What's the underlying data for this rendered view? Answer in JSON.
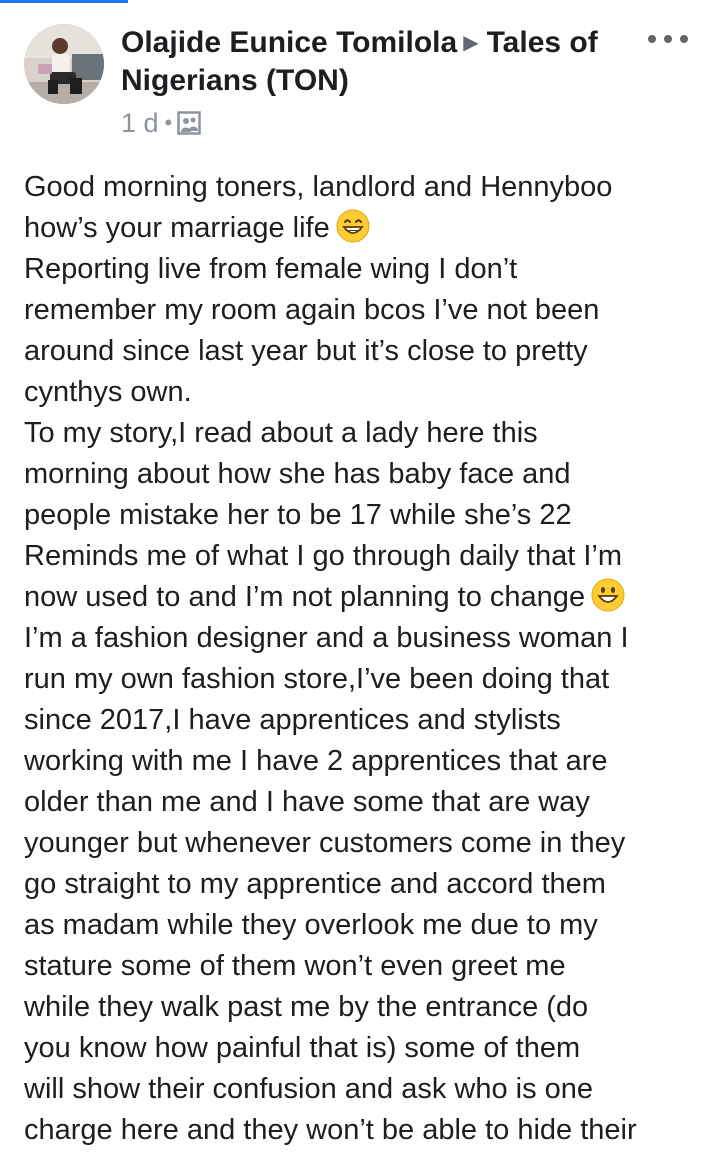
{
  "post": {
    "author": "Olajide Eunice Tomilola",
    "group": "Tales of Nigerians (TON)",
    "arrow_icon": "right-triangle-icon",
    "time": "1 d",
    "separator": "•",
    "audience_icon": "group-icon",
    "more_icon": "ellipsis-icon",
    "lines": [
      "Good morning toners, landlord and Hennyboo",
      "how’s your marriage life",
      "Reporting live from female wing I don’t",
      "remember my room again bcos I’ve not been",
      "around since last year but it’s close to pretty",
      "cynthys own.",
      "To my story,I read about a lady here this",
      "morning about how she has baby face and",
      "people mistake her to be 17 while she’s 22",
      "Reminds me of what I go through daily that I’m",
      "now used to and I’m not planning to change",
      "I’m a fashion designer and a business woman I",
      "run my own fashion store,I’ve been doing that",
      "since 2017,I have apprentices and stylists",
      "working with me I have 2 apprentices that are",
      "older than me and I have some that are way",
      "younger but whenever customers come in they",
      "go straight to my apprentice and accord them",
      "as madam while they overlook me due to my",
      "stature some of them won’t even greet me",
      "while they walk past me by the entrance (do",
      "you know how painful that is) some of them",
      "will show their confusion and ask who is one",
      "charge here and they won’t be able to hide their"
    ],
    "emojis": {
      "line_2": "grinning-face-with-smiling-eyes-emoji",
      "line_11": "grinning-face-emoji"
    }
  },
  "colors": {
    "accent": "#1877f2",
    "text": "#1c1e21",
    "meta": "#8d949e",
    "emoji": "#ffcc33"
  }
}
